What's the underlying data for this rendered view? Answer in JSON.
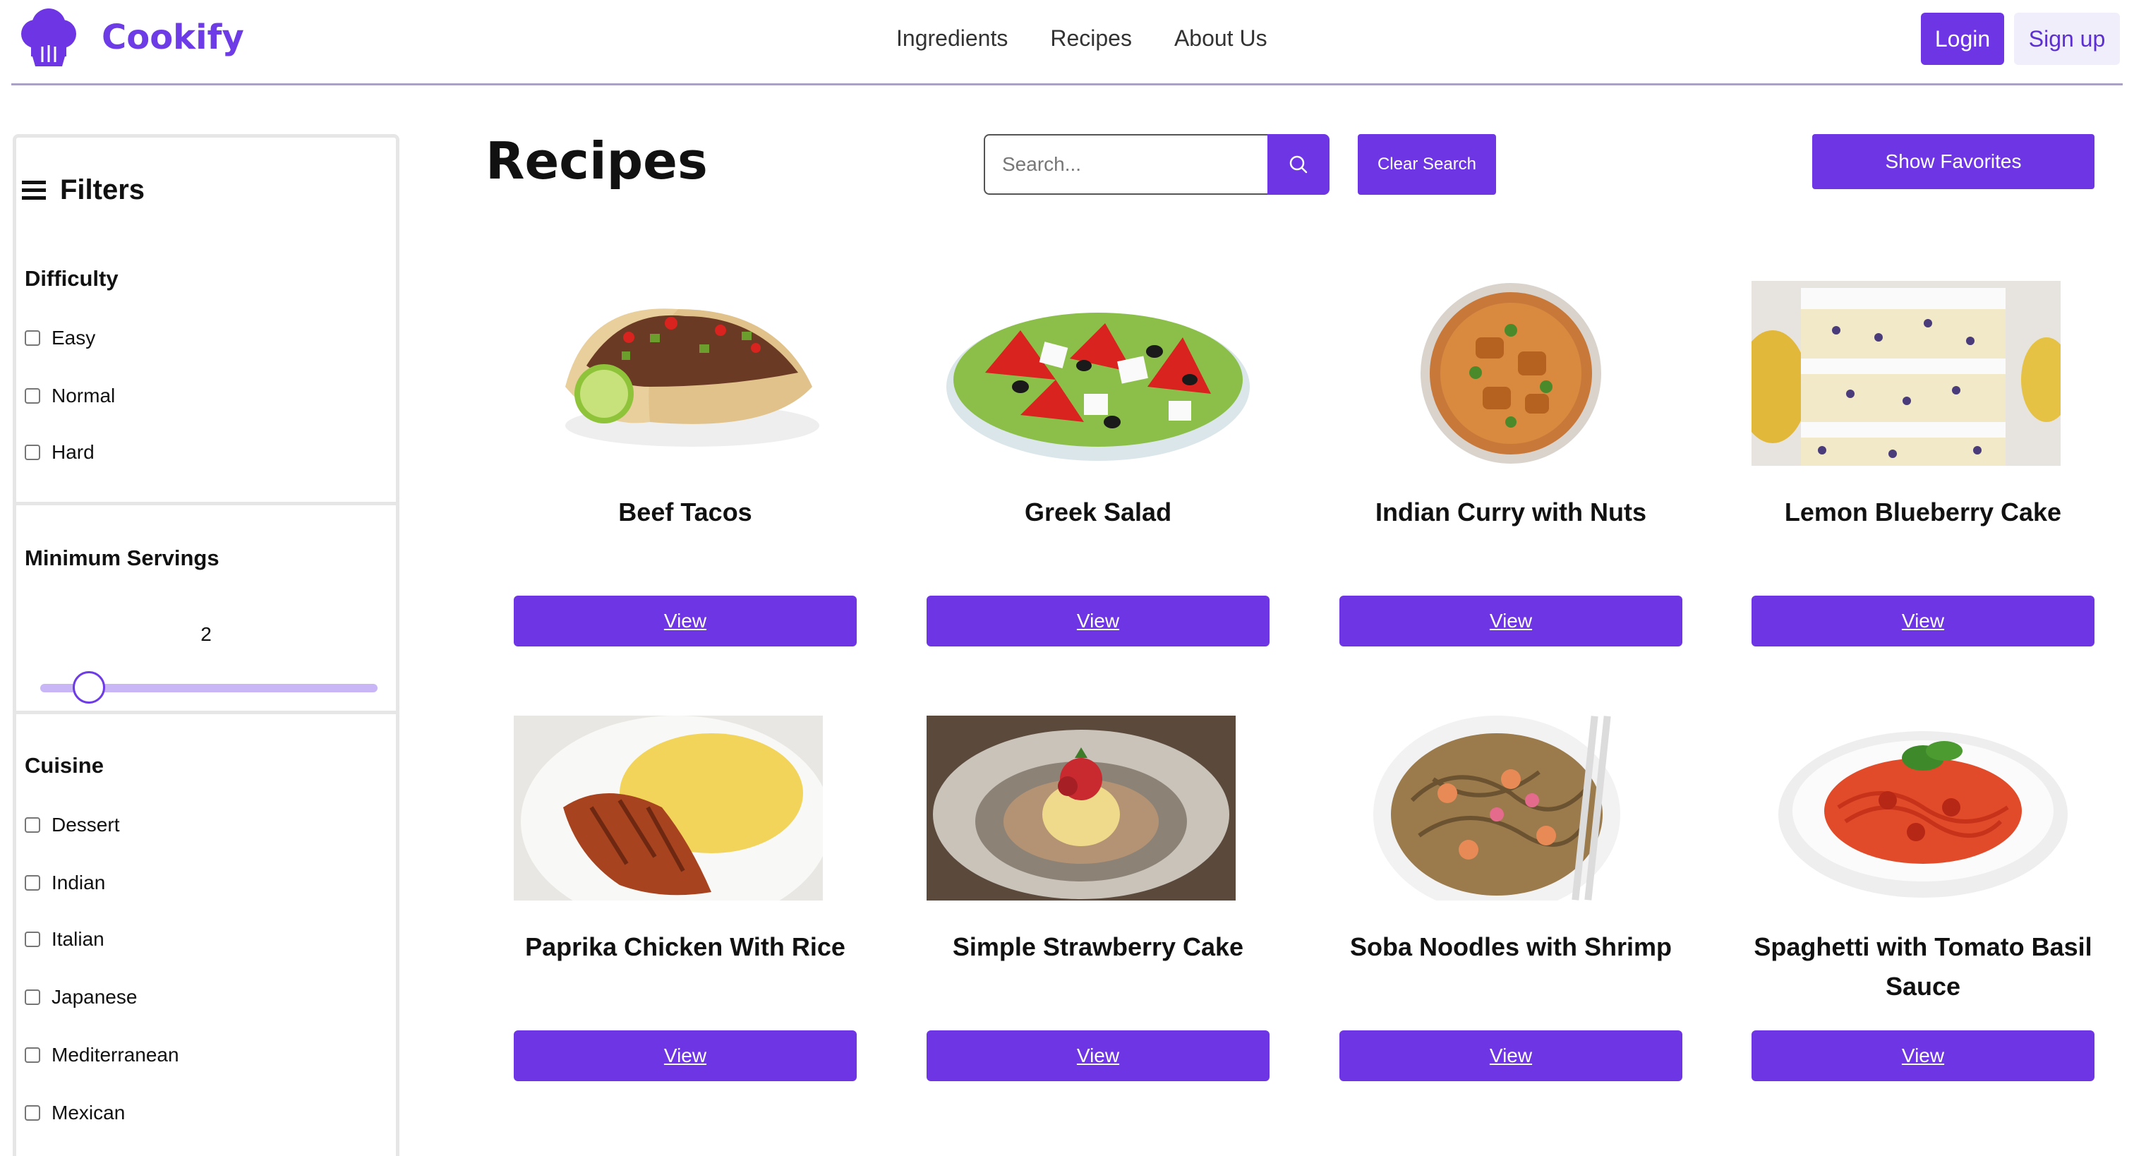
{
  "app": {
    "name": "Cookify",
    "brand_color": "#6d35e3"
  },
  "nav": {
    "items": [
      "Ingredients",
      "Recipes",
      "About Us"
    ]
  },
  "auth": {
    "login_label": "Login",
    "signup_label": "Sign up"
  },
  "sidebar": {
    "title": "Filters",
    "difficulty": {
      "title": "Difficulty",
      "options": [
        "Easy",
        "Normal",
        "Hard"
      ]
    },
    "servings": {
      "title": "Minimum Servings",
      "value": "2"
    },
    "cuisine": {
      "title": "Cuisine",
      "options": [
        "Dessert",
        "Indian",
        "Italian",
        "Japanese",
        "Mediterranean",
        "Mexican"
      ]
    }
  },
  "main": {
    "title": "Recipes",
    "search": {
      "placeholder": "Search..."
    },
    "clear_label": "Clear Search",
    "favorites_label": "Show Favorites",
    "view_label": "View",
    "recipes": [
      {
        "title": "Beef Tacos",
        "image": "beef-tacos-image"
      },
      {
        "title": "Greek Salad",
        "image": "greek-salad-image"
      },
      {
        "title": "Indian Curry with Nuts",
        "image": "indian-curry-image"
      },
      {
        "title": "Lemon Blueberry Cake",
        "image": "lemon-blueberry-cake-image"
      },
      {
        "title": "Paprika Chicken With Rice",
        "image": "paprika-chicken-image"
      },
      {
        "title": "Simple Strawberry Cake",
        "image": "strawberry-cake-image"
      },
      {
        "title": "Soba Noodles with Shrimp",
        "image": "soba-noodles-image"
      },
      {
        "title": "Spaghetti with Tomato Basil Sauce",
        "image": "spaghetti-image"
      }
    ]
  }
}
